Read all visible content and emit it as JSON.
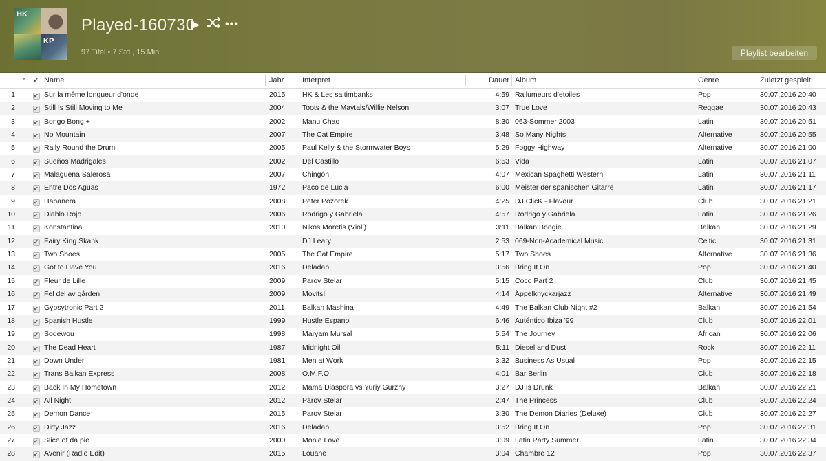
{
  "header": {
    "title": "Played-160730",
    "play_icon": "play-icon",
    "shuffle_icon": "shuffle-icon",
    "more_icon": "more-icon",
    "subtitle": "97 Titel • 7 Std., 15 Min.",
    "edit_button": "Playlist bearbeiten",
    "art_label_1": "HK",
    "art_label_4": "KP",
    "colors": {
      "banner_start": "#6c7133",
      "banner_end": "#86853f",
      "title": "#f2f1e0"
    }
  },
  "columns": {
    "sort": "^",
    "check": "✓",
    "name": "Name",
    "year": "Jahr",
    "artist": "Interpret",
    "duration": "Dauer",
    "album": "Album",
    "genre": "Genre",
    "last_played": "Zuletzt gespielt"
  },
  "tracks": [
    {
      "num": "1",
      "name": "Sur la même longueur d'onde",
      "year": "2015",
      "artist": "HK & Les saltimbanks",
      "duration": "4:59",
      "album": "Rallumeurs d'etoiles",
      "genre": "Pop",
      "last_played": "30.07.2016 20:40"
    },
    {
      "num": "2",
      "name": "Still Is Still Moving to Me",
      "year": "2004",
      "artist": "Toots & the Maytals/Willie Nelson",
      "duration": "3:07",
      "album": "True Love",
      "genre": "Reggae",
      "last_played": "30.07.2016 20:43"
    },
    {
      "num": "3",
      "name": "Bongo Bong +",
      "year": "2002",
      "artist": "Manu Chao",
      "duration": "8:30",
      "album": "063-Sommer 2003",
      "genre": "Latin",
      "last_played": "30.07.2016 20:51"
    },
    {
      "num": "4",
      "name": "No Mountain",
      "year": "2007",
      "artist": "The Cat Empire",
      "duration": "3:48",
      "album": "So Many Nights",
      "genre": "Alternative",
      "last_played": "30.07.2016 20:55"
    },
    {
      "num": "5",
      "name": "Rally Round the Drum",
      "year": "2005",
      "artist": "Paul Kelly & the Stormwater Boys",
      "duration": "5:29",
      "album": "Foggy Highway",
      "genre": "Alternative",
      "last_played": "30.07.2016 21:00"
    },
    {
      "num": "6",
      "name": "Sueños Madrigales",
      "year": "2002",
      "artist": "Del Castillo",
      "duration": "6:53",
      "album": "Vida",
      "genre": "Latin",
      "last_played": "30.07.2016 21:07"
    },
    {
      "num": "7",
      "name": "Malaguena Salerosa",
      "year": "2007",
      "artist": "Chingón",
      "duration": "4:07",
      "album": "Mexican Spaghetti Western",
      "genre": "Latin",
      "last_played": "30.07.2016 21:11"
    },
    {
      "num": "8",
      "name": "Entre Dos Aguas",
      "year": "1972",
      "artist": "Paco de Lucia",
      "duration": "6:00",
      "album": "Meister der spanischen Gitarre",
      "genre": "Latin",
      "last_played": "30.07.2016 21:17"
    },
    {
      "num": "9",
      "name": "Habanera",
      "year": "2008",
      "artist": "Peter Pozorek",
      "duration": "4:25",
      "album": "DJ ClicK - Flavour",
      "genre": "Club",
      "last_played": "30.07.2016 21:21"
    },
    {
      "num": "10",
      "name": "Diablo Rojo",
      "year": "2006",
      "artist": "Rodrigo y Gabriela",
      "duration": "4:57",
      "album": "Rodrigo y Gabriela",
      "genre": "Latin",
      "last_played": "30.07.2016 21:26"
    },
    {
      "num": "11",
      "name": "Konstantina",
      "year": "2010",
      "artist": "Nikos Moretis (Violi)",
      "duration": "3:11",
      "album": "Balkan Boogie",
      "genre": "Balkan",
      "last_played": "30.07.2016 21:29"
    },
    {
      "num": "12",
      "name": "Fairy King Skank",
      "year": "",
      "artist": "DJ Leary",
      "duration": "2:53",
      "album": "069-Non-Academical Music",
      "genre": "Celtic",
      "last_played": "30.07.2016 21:31"
    },
    {
      "num": "13",
      "name": "Two Shoes",
      "year": "2005",
      "artist": "The Cat Empire",
      "duration": "5:17",
      "album": "Two Shoes",
      "genre": "Alternative",
      "last_played": "30.07.2016 21:36"
    },
    {
      "num": "14",
      "name": "Got to Have You",
      "year": "2016",
      "artist": "Deladap",
      "duration": "3:56",
      "album": "Bring It On",
      "genre": "Pop",
      "last_played": "30.07.2016 21:40"
    },
    {
      "num": "15",
      "name": "Fleur de Lille",
      "year": "2009",
      "artist": "Parov Stelar",
      "duration": "5:15",
      "album": "Coco Part 2",
      "genre": "Club",
      "last_played": "30.07.2016 21:45"
    },
    {
      "num": "16",
      "name": "Fel del av gården",
      "year": "2009",
      "artist": "Movits!",
      "duration": "4:14",
      "album": "Äppelknyckarjazz",
      "genre": "Alternative",
      "last_played": "30.07.2016 21:49"
    },
    {
      "num": "17",
      "name": "Gypsytronic Part 2",
      "year": "2011",
      "artist": "Balkan Mashina",
      "duration": "4:49",
      "album": "The Balkan Club Night #2",
      "genre": "Balkan",
      "last_played": "30.07.2016 21:54"
    },
    {
      "num": "18",
      "name": "Spanish Hustle",
      "year": "1999",
      "artist": "Hustle Espanol",
      "duration": "6:46",
      "album": "Auténtico Ibiza '99",
      "genre": "Club",
      "last_played": "30.07.2016 22:01"
    },
    {
      "num": "19",
      "name": "Sodewou",
      "year": "1998",
      "artist": "Maryam Mursal",
      "duration": "5:54",
      "album": "The Journey",
      "genre": "African",
      "last_played": "30.07.2016 22:06"
    },
    {
      "num": "20",
      "name": "The Dead Heart",
      "year": "1987",
      "artist": "Midnight Oil",
      "duration": "5:11",
      "album": "Diesel and Dust",
      "genre": "Rock",
      "last_played": "30.07.2016 22:11"
    },
    {
      "num": "21",
      "name": "Down Under",
      "year": "1981",
      "artist": "Men at Work",
      "duration": "3:32",
      "album": "Business As Usual",
      "genre": "Pop",
      "last_played": "30.07.2016 22:15"
    },
    {
      "num": "22",
      "name": "Trans Balkan Express",
      "year": "2008",
      "artist": "O.M.F.O.",
      "duration": "4:01",
      "album": "Bar Berlin",
      "genre": "Club",
      "last_played": "30.07.2016 22:18"
    },
    {
      "num": "23",
      "name": "Back In My Hometown",
      "year": "2012",
      "artist": "Mama Diaspora vs Yuriy Gurzhy",
      "duration": "3:27",
      "album": "DJ Is Drunk",
      "genre": "Balkan",
      "last_played": "30.07.2016 22:21"
    },
    {
      "num": "24",
      "name": "All Night",
      "year": "2012",
      "artist": "Parov Stelar",
      "duration": "2:47",
      "album": "The Princess",
      "genre": "Club",
      "last_played": "30.07.2016 22:24"
    },
    {
      "num": "25",
      "name": "Demon Dance",
      "year": "2015",
      "artist": "Parov Stelar",
      "duration": "3:30",
      "album": "The Demon Diaries (Deluxe)",
      "genre": "Club",
      "last_played": "30.07.2016 22:27"
    },
    {
      "num": "26",
      "name": "Dirty Jazz",
      "year": "2016",
      "artist": "Deladap",
      "duration": "3:52",
      "album": "Bring It On",
      "genre": "Pop",
      "last_played": "30.07.2016 22:31"
    },
    {
      "num": "27",
      "name": "Slice of da pie",
      "year": "2000",
      "artist": "Monie Love",
      "duration": "3:09",
      "album": "Latin Party Summer",
      "genre": "Latin",
      "last_played": "30.07.2016 22:34"
    },
    {
      "num": "28",
      "name": "Avenir (Radio Edit)",
      "year": "2015",
      "artist": "Louane",
      "duration": "3:04",
      "album": "Chambre 12",
      "genre": "Pop",
      "last_played": "30.07.2016 22:37"
    }
  ]
}
